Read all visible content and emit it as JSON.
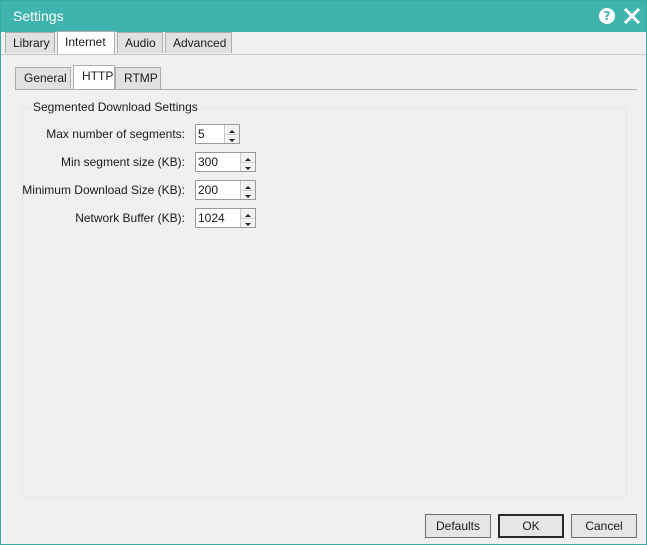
{
  "window": {
    "title": "Settings"
  },
  "titlebar": {
    "help_label": "?"
  },
  "main_tabs": [
    {
      "label": "Library",
      "active": false
    },
    {
      "label": "Internet",
      "active": true
    },
    {
      "label": "Audio",
      "active": false
    },
    {
      "label": "Advanced",
      "active": false
    }
  ],
  "sub_tabs": [
    {
      "label": "General",
      "active": false
    },
    {
      "label": "HTTP",
      "active": true
    },
    {
      "label": "RTMP",
      "active": false
    }
  ],
  "group": {
    "title": "Segmented Download Settings",
    "fields": [
      {
        "label": "Max number of segments:",
        "value": "5"
      },
      {
        "label": "Min segment size (KB):",
        "value": "300"
      },
      {
        "label": "Minimum Download Size (KB):",
        "value": "200"
      },
      {
        "label": "Network Buffer (KB):",
        "value": "1024"
      }
    ]
  },
  "buttons": {
    "defaults": "Defaults",
    "ok": "OK",
    "cancel": "Cancel"
  },
  "colors": {
    "titlebar": "#3fb3ad",
    "background": "#f0f0f0"
  }
}
